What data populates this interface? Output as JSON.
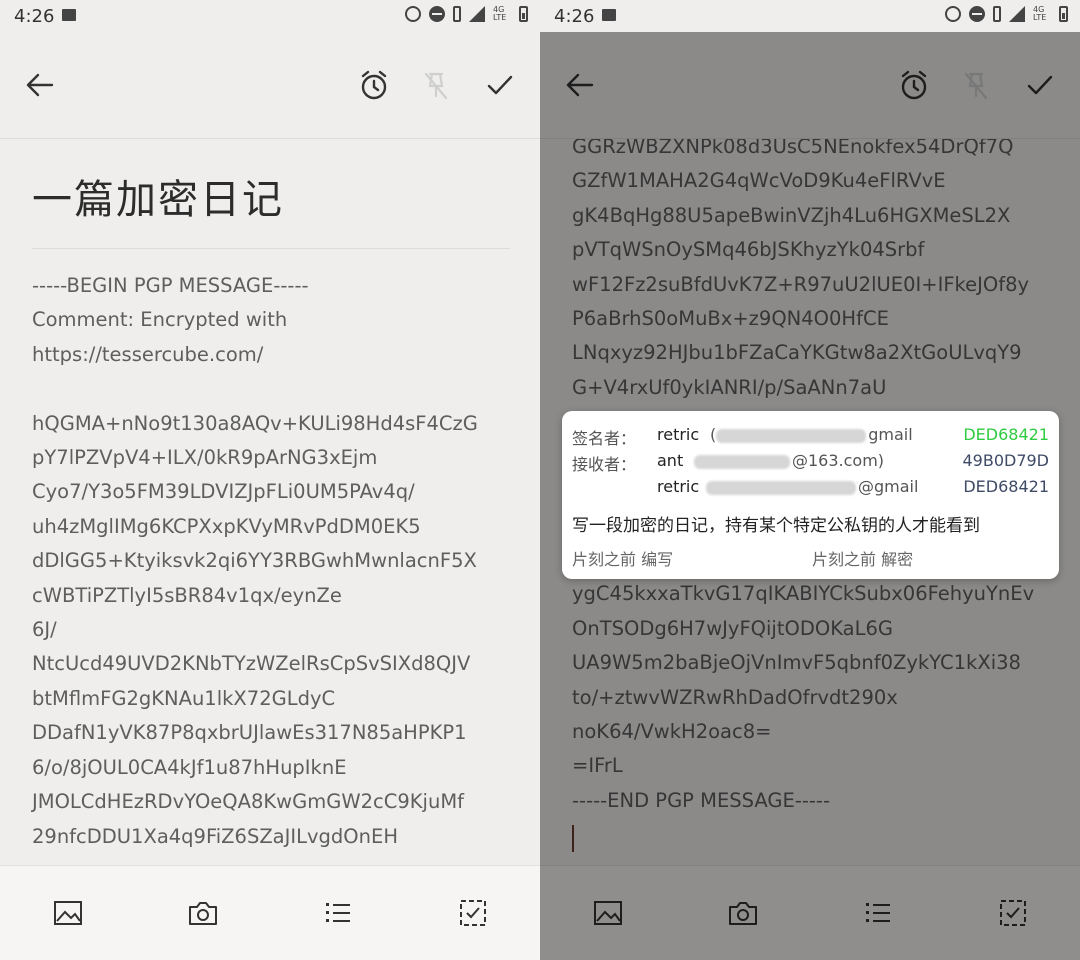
{
  "status": {
    "time": "4:26",
    "network": "4G LTE"
  },
  "left": {
    "title": "一篇加密日记",
    "body": [
      "-----BEGIN PGP MESSAGE-----",
      "Comment: Encrypted with",
      "https://tessercube.com/",
      "",
      "hQGMA+nNo9t130a8AQv+KULi98Hd4sF4CzG",
      "pY7lPZVpV4+ILX/0kR9pArNG3xEjm",
      "Cyo7/Y3o5FM39LDVIZJpFLi0UM5PAv4q/",
      "uh4zMglIMg6KCPXxpKVyMRvPdDM0EK5",
      "dDlGG5+Ktyiksvk2qi6YY3RBGwhMwnlacnF5X",
      "cWBTiPZTlyI5sBR84v1qx/eynZe",
      "6J/",
      "NtcUcd49UVD2KNbTYzWZelRsCpSvSIXd8QJV",
      "btMflmFG2gKNAu1lkX72GLdyC",
      "DDafN1yVK87P8qxbrUJlawEs317N85aHPKP1",
      "6/o/8jOUL0CA4kJf1u87hHupIknE",
      "JMOLCdHEzRDvYOeQA8KwGmGW2cC9KjuMf",
      "29nfcDDU1Xa4q9FiZ6SZaJILvgdOnEH"
    ]
  },
  "right": {
    "body": [
      "GGRzWBZXNPk08d3UsC5NEnokfex54DrQf7Q",
      "GZfW1MAHA2G4qWcVoD9Ku4eFlRVvE",
      "gK4BqHg88U5apeBwinVZjh4Lu6HGXMeSL2X",
      "pVTqWSnOySMq46bJSKhyzYk04Srbf",
      "wF12Fz2suBfdUvK7Z+R97uU2lUE0I+IFkeJOf8y",
      "P6aBrhS0oMuBx+z9QN4O0HfCE",
      "LNqxyz92HJbu1bFZaCaYKGtw8a2XtGoULvqY9",
      "G+V4rxUf0ykIANRI/p/SaANn7aU",
      "",
      "",
      "",
      "",
      "",
      "ygC45kxxaTkvG17qIKABIYCkSubx06FehyuYnEv",
      "OnTSODg6H7wJyFQijtODOKaL6G",
      "UA9W5m2baBjeOjVnImvF5qbnf0ZykYC1kXi38",
      "to/+ztwvWZRwRhDadOfrvdt290x",
      "noK64/VwkH2oac8=",
      "=IFrL",
      "-----END PGP MESSAGE-----"
    ],
    "card": {
      "signer_label": "签名者：",
      "receiver_label": "接收者：",
      "rows": [
        {
          "name": "retric",
          "email_prefix": "(",
          "email_suffix": "gmail",
          "key": "DED68421",
          "key_color": "#2fcb40"
        },
        {
          "name": "ant",
          "email_prefix": "",
          "email_suffix": "@163.com)",
          "key": "49B0D79D",
          "key_color": "#3e4a66"
        },
        {
          "name": "retric",
          "email_prefix": "",
          "email_suffix": "@gmail",
          "key": "DED68421",
          "key_color": "#3e4a66"
        }
      ],
      "message": "写一段加密的日记，持有某个特定公私钥的人才能看到",
      "edited": "片刻之前 编写",
      "decrypted": "片刻之前 解密"
    }
  }
}
